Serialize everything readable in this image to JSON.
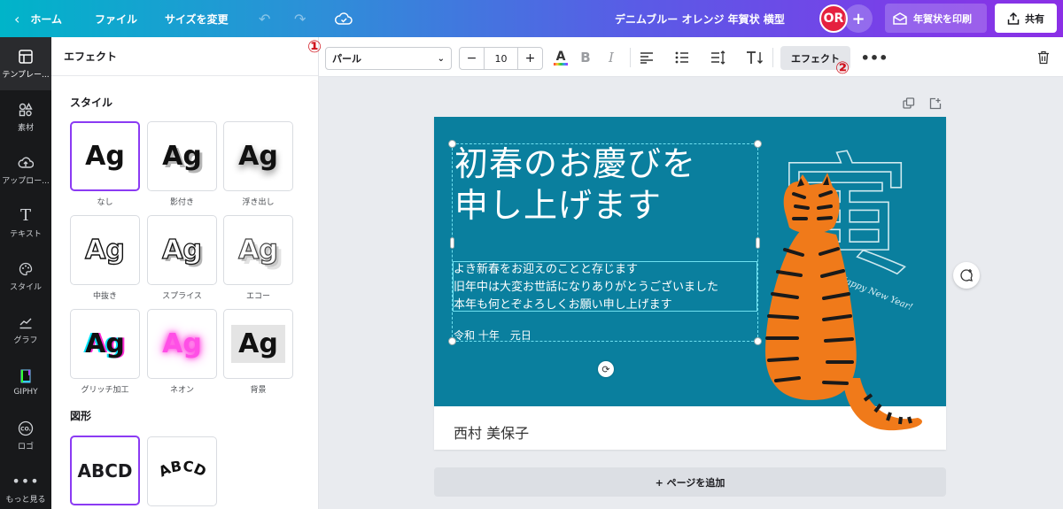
{
  "topbar": {
    "home": "ホーム",
    "file": "ファイル",
    "resize": "サイズを変更",
    "design_title": "デニムブルー オレンジ 年賀状 横型",
    "avatar_initials": "OR",
    "print_label": "年賀状を印刷",
    "share_label": "共有"
  },
  "rail": [
    {
      "label": "テンプレー...",
      "icon": "template-icon"
    },
    {
      "label": "素材",
      "icon": "elements-icon"
    },
    {
      "label": "アップロー...",
      "icon": "upload-icon"
    },
    {
      "label": "テキスト",
      "icon": "text-icon"
    },
    {
      "label": "スタイル",
      "icon": "palette-icon"
    },
    {
      "label": "グラフ",
      "icon": "chart-icon"
    },
    {
      "label": "GIPHY",
      "icon": "giphy-icon"
    },
    {
      "label": "ロゴ",
      "icon": "logo-icon"
    },
    {
      "label": "もっと見る",
      "icon": "more-icon"
    }
  ],
  "panel": {
    "title": "エフェクト",
    "style_section": "スタイル",
    "shape_section": "図形",
    "sample_text": "Ag",
    "styles": [
      {
        "label": "なし",
        "selected": true
      },
      {
        "label": "影付き"
      },
      {
        "label": "浮き出し"
      },
      {
        "label": "中抜き"
      },
      {
        "label": "スプライス"
      },
      {
        "label": "エコー"
      },
      {
        "label": "グリッチ加工"
      },
      {
        "label": "ネオン"
      },
      {
        "label": "背景"
      }
    ],
    "shapes": [
      {
        "text": "ABCD",
        "selected": true
      },
      {
        "text": "ABCD"
      }
    ]
  },
  "toolbar": {
    "font": "パール",
    "font_size": "10",
    "effect_label": "エフェクト",
    "marker_1": "①",
    "marker_2": "②"
  },
  "card": {
    "headline_1": "初春のお慶びを",
    "headline_2": "申し上げます",
    "greeting_1": "よき新春をお迎えのことと存じます",
    "greeting_2": "旧年中は大変お世話になりありがとうございました",
    "greeting_3": "本年も何とぞよろしくお願い申し上げます",
    "date": "令和 十年　元日",
    "kanji": "寅",
    "happy": "Happy New Year!",
    "sender": "西村 美保子"
  },
  "add_page": "+ ページを追加",
  "colors": {
    "accent": "#8b3bf3",
    "card_bg": "#0a7f9e",
    "tiger_orange": "#f07a1a"
  }
}
